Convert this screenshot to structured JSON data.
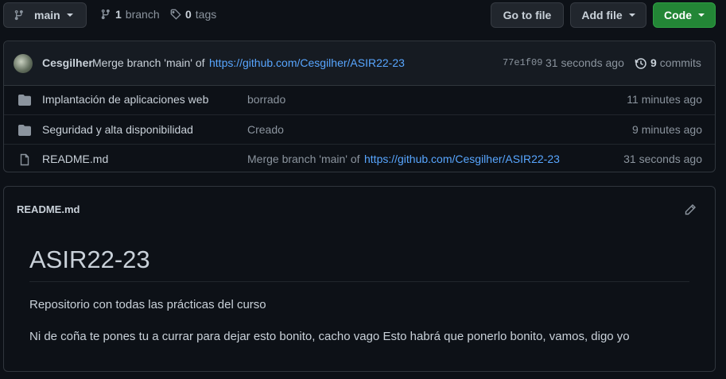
{
  "toolbar": {
    "branch_label": "main",
    "branches_count": "1",
    "branches_label": "branch",
    "tags_count": "0",
    "tags_label": "tags",
    "go_to_file": "Go to file",
    "add_file": "Add file",
    "code": "Code"
  },
  "commit": {
    "author": "Cesgilher",
    "message": "Merge branch 'main' of",
    "link": "https://github.com/Cesgilher/ASIR22-23",
    "hash": "77e1f09",
    "time": "31 seconds ago",
    "commits_count": "9",
    "commits_label": "commits"
  },
  "files": [
    {
      "name": "Implantación de aplicaciones web",
      "message": "borrado",
      "link": "",
      "time": "11 minutes ago",
      "icon": "folder-icon"
    },
    {
      "name": "Seguridad y alta disponibilidad",
      "message": "Creado",
      "link": "",
      "time": "9 minutes ago",
      "icon": "folder-icon"
    },
    {
      "name": "README.md",
      "message": "Merge branch 'main' of",
      "link": "https://github.com/Cesgilher/ASIR22-23",
      "time": "31 seconds ago",
      "icon": "file-icon"
    }
  ],
  "readme": {
    "filename": "README.md",
    "title": "ASIR22-23",
    "paragraph1": "Repositorio con todas las prácticas del curso",
    "paragraph2": "Ni de coña te pones tu a currar para dejar esto bonito, cacho vago Esto habrá que ponerlo bonito, vamos, digo yo"
  },
  "colors": {
    "background": "#0d1117",
    "link": "#58a6ff",
    "primary_button": "#238636"
  }
}
